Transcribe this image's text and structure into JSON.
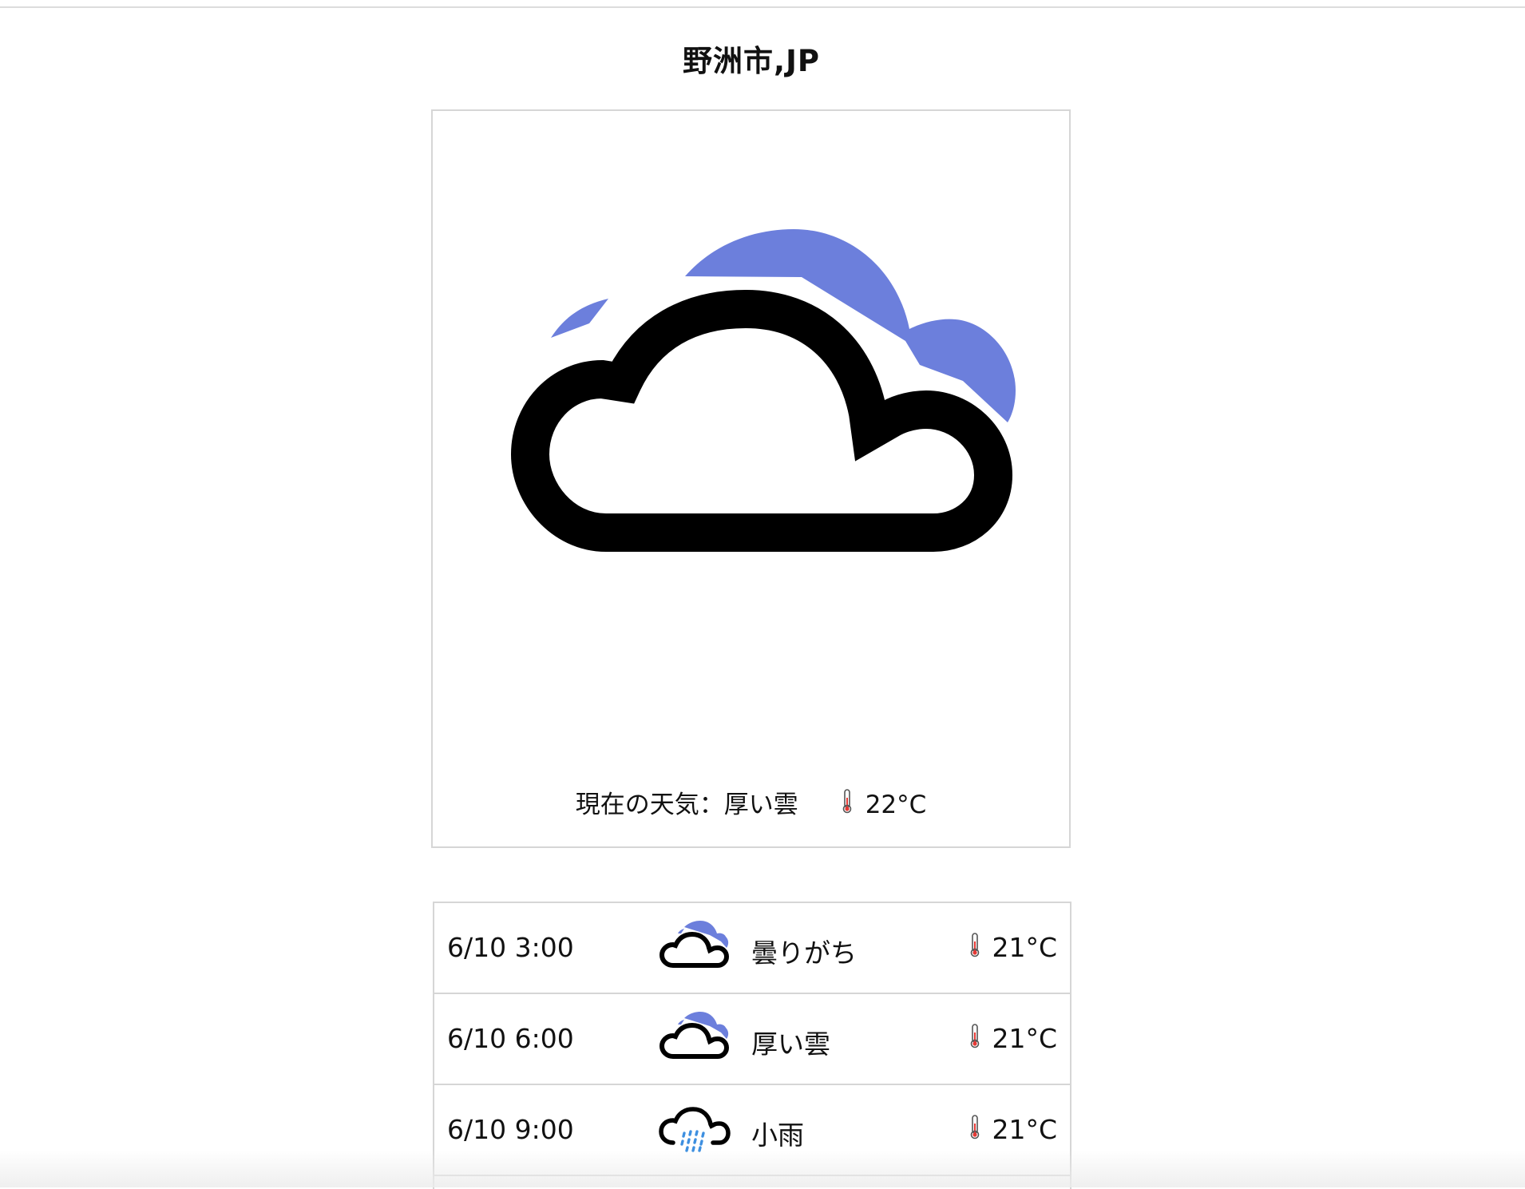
{
  "header": {
    "city": "野洲市,JP"
  },
  "current": {
    "label": "現在の天気：厚い雲",
    "temp": "22°C",
    "icon": "broken-clouds-icon"
  },
  "forecast": [
    {
      "time": "6/10 3:00",
      "desc": "曇りがち",
      "temp": "21°C",
      "icon": "broken-clouds-icon"
    },
    {
      "time": "6/10 6:00",
      "desc": "厚い雲",
      "temp": "21°C",
      "icon": "broken-clouds-icon"
    },
    {
      "time": "6/10 9:00",
      "desc": "小雨",
      "temp": "21°C",
      "icon": "light-rain-icon"
    }
  ],
  "colors": {
    "cloud_back": "#6c7fdc",
    "cloud_outline": "#000000",
    "rain": "#3d8fe0",
    "thermometer_red": "#e53935",
    "border": "#d6d6d6"
  }
}
